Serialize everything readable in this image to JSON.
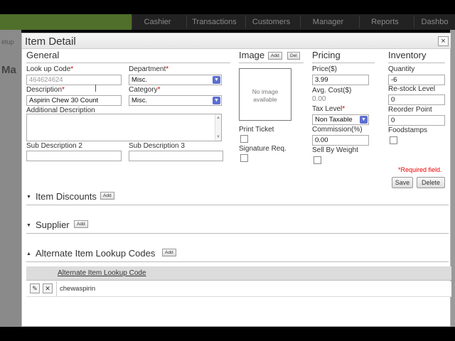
{
  "app": {
    "nav_tabs": [
      "Cashier",
      "Transactions",
      "Customers",
      "Manager",
      "Reports",
      "Dashbo"
    ],
    "left_fragments": [
      "etup",
      "Ma"
    ]
  },
  "dialog": {
    "title": "Item Detail",
    "close_glyph": "×",
    "general": {
      "title": "General",
      "lookup_code_label": "Look up Code",
      "lookup_code_value": "464624624",
      "department_label": "Department",
      "department_value": "Misc.",
      "description_label": "Description",
      "description_value": "Aspirin Chew 30 Count",
      "category_label": "Category",
      "category_value": "Misc.",
      "additional_description_label": "Additional Description",
      "additional_description_value": "",
      "sub_description_2_label": "Sub Description 2",
      "sub_description_2_value": "",
      "sub_description_3_label": "Sub Description 3",
      "sub_description_3_value": "",
      "required_marker": "*"
    },
    "image": {
      "title": "Image",
      "add_label": "Add",
      "del_label": "Del",
      "placeholder": "No image available",
      "print_ticket_label": "Print Ticket",
      "print_ticket_checked": false,
      "signature_req_label": "Signature Req.",
      "signature_req_checked": false
    },
    "pricing": {
      "title": "Pricing",
      "price_label": "Price($)",
      "price_value": "3.99",
      "avg_cost_label": "Avg. Cost($)",
      "avg_cost_value": "0.00",
      "tax_level_label": "Tax Level",
      "tax_level_value": "Non Taxable",
      "commission_label": "Commission(%)",
      "commission_value": "0.00",
      "sell_by_weight_label": "Sell By Weight",
      "sell_by_weight_checked": false
    },
    "inventory": {
      "title": "Inventory",
      "quantity_label": "Quantity",
      "quantity_value": "-6",
      "restock_label": "Re-stock Level",
      "restock_value": "0",
      "reorder_label": "Reorder Point",
      "reorder_value": "0",
      "foodstamps_label": "Foodstamps",
      "foodstamps_checked": false
    },
    "required_note": "*Required field.",
    "save_label": "Save",
    "delete_label": "Delete",
    "sections": {
      "item_discounts": {
        "label": "Item Discounts",
        "add_label": "Add",
        "expanded": false
      },
      "supplier": {
        "label": "Supplier",
        "add_label": "Add",
        "expanded": false
      },
      "alternate_lookup": {
        "label": "Alternate Item Lookup Codes",
        "add_label": "Add",
        "expanded": true
      }
    },
    "alternate_table": {
      "column_header": "Alternate Item Lookup Code",
      "rows": [
        {
          "code": "chewaspirin",
          "edit_icon": "pencil-icon",
          "delete_icon": "x-icon"
        }
      ]
    }
  },
  "colors": {
    "accent_green": "#4f6f2a",
    "required_red": "#dd0000",
    "dropdown_blue": "#5d6fd0"
  }
}
